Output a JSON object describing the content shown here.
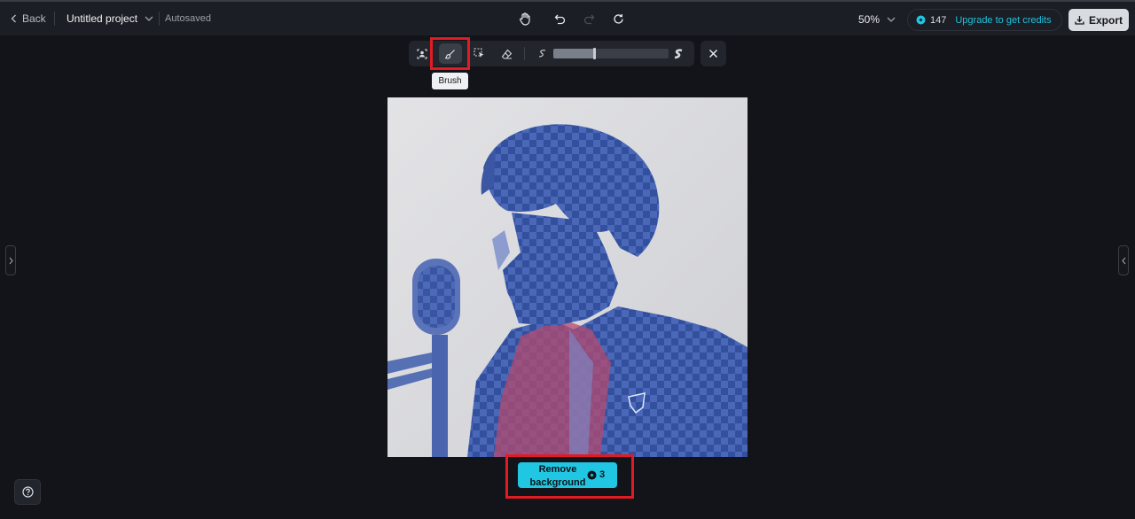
{
  "topbar": {
    "back_label": "Back",
    "project_name": "Untitled project",
    "save_status": "Autosaved",
    "zoom_level": "50%",
    "credits_count": "147",
    "upgrade_label": "Upgrade to get credits",
    "export_label": "Export"
  },
  "brush_toolbar": {
    "tooltip": "Brush",
    "brush_size_fraction": 0.35
  },
  "remove_button": {
    "line1": "Remove",
    "line2": "background",
    "cost": "3"
  },
  "colors": {
    "accent": "#21c6e3",
    "highlight": "#e01b24",
    "mask_overlay": "#3a5cbf"
  }
}
